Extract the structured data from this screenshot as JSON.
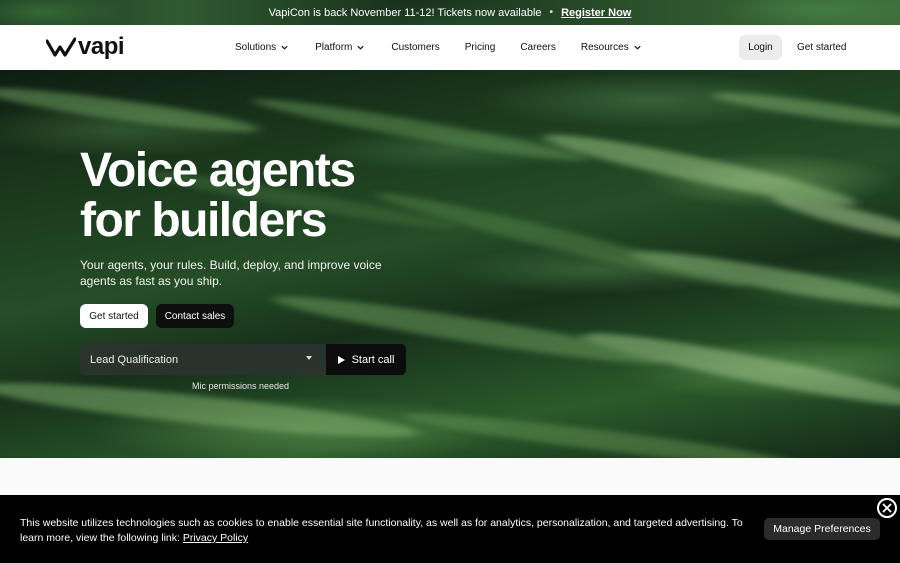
{
  "announcement": {
    "text": "VapiCon is back November 11-12! Tickets now available",
    "separator": "•",
    "link": "Register Now"
  },
  "nav": {
    "logo": "vapi",
    "items": [
      {
        "label": "Solutions",
        "has_dropdown": true
      },
      {
        "label": "Platform",
        "has_dropdown": true
      },
      {
        "label": "Customers",
        "has_dropdown": false
      },
      {
        "label": "Pricing",
        "has_dropdown": false
      },
      {
        "label": "Careers",
        "has_dropdown": false
      },
      {
        "label": "Resources",
        "has_dropdown": true
      }
    ],
    "login": "Login",
    "get_started": "Get started"
  },
  "hero": {
    "title_line1": "Voice agents",
    "title_line2": "for builders",
    "subtitle": "Your agents, your rules. Build, deploy, and improve voice agents as fast as you ship.",
    "primary_button": "Get started",
    "secondary_button": "Contact sales",
    "select_value": "Lead Qualification",
    "start_call": "Start call",
    "mic_note": "Mic permissions needed"
  },
  "cookie": {
    "text": "This website utilizes technologies such as cookies to enable essential site functionality, as well as for analytics, personalization, and targeted advertising. To learn more, view the following link:",
    "link": "Privacy Policy",
    "manage": "Manage Preferences"
  },
  "colors": {
    "hero_dark": "#0e1d12",
    "hero_green": "#254d26",
    "banner_bg": "#000000"
  }
}
